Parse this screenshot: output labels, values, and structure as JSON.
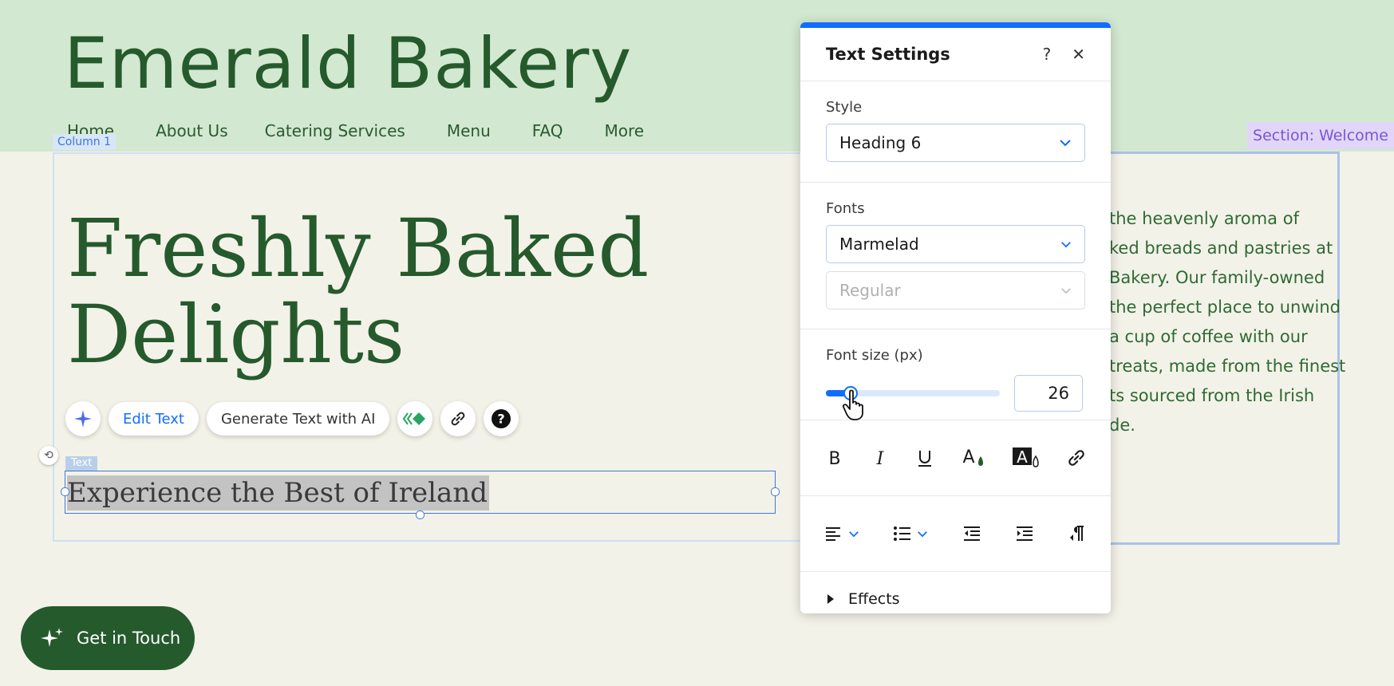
{
  "site": {
    "title": "Emerald Bakery",
    "nav": [
      "Home",
      "About Us",
      "Catering Services",
      "Menu",
      "FAQ",
      "More"
    ],
    "section_badge": "Section: Welcome",
    "column_label": "Column 1",
    "hero_line1": "Freshly Baked",
    "hero_line2": "Delights",
    "text_tag": "Text",
    "selected_text": "Experience the Best of Ireland",
    "body_lines": [
      "the heavenly aroma of",
      "ked breads and pastries at",
      "Bakery. Our family-owned",
      "the perfect place to unwind",
      "a cup of coffee with our",
      "treats, made from the finest",
      "ts sourced from the Irish",
      "de."
    ],
    "cta_label": "Get in Touch"
  },
  "toolbar": {
    "edit_text": "Edit Text",
    "generate_ai": "Generate Text with AI"
  },
  "panel": {
    "title": "Text Settings",
    "help": "?",
    "close": "✕",
    "style_label": "Style",
    "style_value": "Heading 6",
    "fonts_label": "Fonts",
    "font_value": "Marmelad",
    "weight_placeholder": "Regular",
    "font_size_label": "Font size (px)",
    "font_size_value": "26",
    "font_size_fraction": 0.14,
    "effects_label": "Effects"
  },
  "colors": {
    "accent": "#116dff",
    "brand_green": "#255a2d",
    "header_bg": "#d3e8d0",
    "page_bg": "#f3f2e8"
  }
}
